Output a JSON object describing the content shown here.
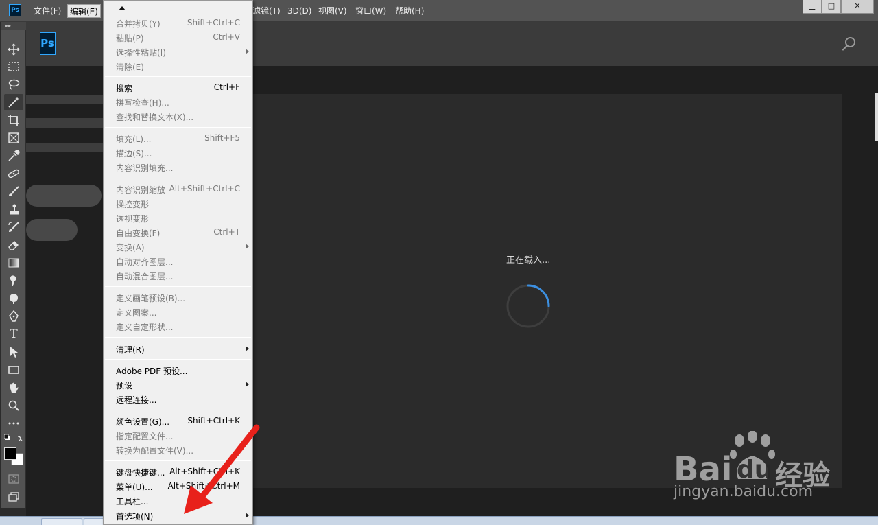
{
  "app": {
    "icon_text": "Ps",
    "logo_text": "Ps",
    "accent": "#31a8ff"
  },
  "menubar": {
    "items": [
      {
        "label": "文件(F)"
      },
      {
        "label": "编辑(E)",
        "active": true
      },
      {
        "label": "滤镜(T)"
      },
      {
        "label": "3D(D)"
      },
      {
        "label": "视图(V)"
      },
      {
        "label": "窗口(W)"
      },
      {
        "label": "帮助(H)"
      }
    ],
    "window_buttons": [
      "minimize",
      "maximize",
      "close"
    ]
  },
  "toolbar": {
    "grip": "▸▸",
    "tools": [
      "move-tool-icon",
      "marquee-tool-icon",
      "lasso-tool-icon",
      "magic-wand-tool-icon",
      "crop-tool-icon",
      "frame-tool-icon",
      "eyedropper-tool-icon",
      "healing-tool-icon",
      "brush-tool-icon",
      "clone-stamp-tool-icon",
      "history-brush-tool-icon",
      "eraser-tool-icon",
      "gradient-tool-icon",
      "smudge-tool-icon",
      "dodge-tool-icon",
      "pen-tool-icon",
      "type-tool-icon",
      "path-selection-tool-icon",
      "rectangle-tool-icon",
      "hand-tool-icon",
      "zoom-tool-icon",
      "more-tools-icon"
    ],
    "type_tool_glyph": "T"
  },
  "home": {
    "loading_text": "正在载入...",
    "spinner_color": "#3c8fe0"
  },
  "edit_menu": {
    "items": [
      {
        "label": "合并拷贝(Y)",
        "shortcut": "Shift+Ctrl+C",
        "enabled": false
      },
      {
        "label": "粘贴(P)",
        "shortcut": "Ctrl+V",
        "enabled": false
      },
      {
        "label": "选择性粘贴(I)",
        "shortcut": "",
        "enabled": false,
        "submenu": true
      },
      {
        "label": "清除(E)",
        "shortcut": "",
        "enabled": false
      },
      {
        "sep": true
      },
      {
        "label": "搜索",
        "shortcut": "Ctrl+F",
        "enabled": true
      },
      {
        "label": "拼写检查(H)...",
        "shortcut": "",
        "enabled": false
      },
      {
        "label": "查找和替换文本(X)...",
        "shortcut": "",
        "enabled": false
      },
      {
        "sep": true
      },
      {
        "label": "填充(L)...",
        "shortcut": "Shift+F5",
        "enabled": false
      },
      {
        "label": "描边(S)...",
        "shortcut": "",
        "enabled": false
      },
      {
        "label": "内容识别填充...",
        "shortcut": "",
        "enabled": false
      },
      {
        "sep": true
      },
      {
        "label": "内容识别缩放",
        "shortcut": "Alt+Shift+Ctrl+C",
        "enabled": false
      },
      {
        "label": "操控变形",
        "shortcut": "",
        "enabled": false
      },
      {
        "label": "透视变形",
        "shortcut": "",
        "enabled": false
      },
      {
        "label": "自由变换(F)",
        "shortcut": "Ctrl+T",
        "enabled": false
      },
      {
        "label": "变换(A)",
        "shortcut": "",
        "enabled": false,
        "submenu": true
      },
      {
        "label": "自动对齐图层...",
        "shortcut": "",
        "enabled": false
      },
      {
        "label": "自动混合图层...",
        "shortcut": "",
        "enabled": false
      },
      {
        "sep": true
      },
      {
        "label": "定义画笔预设(B)...",
        "shortcut": "",
        "enabled": false
      },
      {
        "label": "定义图案...",
        "shortcut": "",
        "enabled": false
      },
      {
        "label": "定义自定形状...",
        "shortcut": "",
        "enabled": false
      },
      {
        "sep": true
      },
      {
        "label": "清理(R)",
        "shortcut": "",
        "enabled": true,
        "submenu": true
      },
      {
        "sep": true
      },
      {
        "label": "Adobe PDF 预设...",
        "shortcut": "",
        "enabled": true
      },
      {
        "label": "预设",
        "shortcut": "",
        "enabled": true,
        "submenu": true
      },
      {
        "label": "远程连接...",
        "shortcut": "",
        "enabled": true
      },
      {
        "sep": true
      },
      {
        "label": "颜色设置(G)...",
        "shortcut": "Shift+Ctrl+K",
        "enabled": true
      },
      {
        "label": "指定配置文件...",
        "shortcut": "",
        "enabled": false
      },
      {
        "label": "转换为配置文件(V)...",
        "shortcut": "",
        "enabled": false
      },
      {
        "sep": true
      },
      {
        "label": "键盘快捷键...",
        "shortcut": "Alt+Shift+Ctrl+K",
        "enabled": true
      },
      {
        "label": "菜单(U)...",
        "shortcut": "Alt+Shift+Ctrl+M",
        "enabled": true
      },
      {
        "label": "工具栏...",
        "shortcut": "",
        "enabled": true
      },
      {
        "label": "首选项(N)",
        "shortcut": "",
        "enabled": true,
        "submenu": true
      }
    ]
  },
  "annotation": {
    "arrow_color": "#e8211b"
  },
  "watermark": {
    "word_left": "Bai",
    "word_mid": "du",
    "word_right": "经验",
    "url": "jingyan.baidu.com"
  }
}
